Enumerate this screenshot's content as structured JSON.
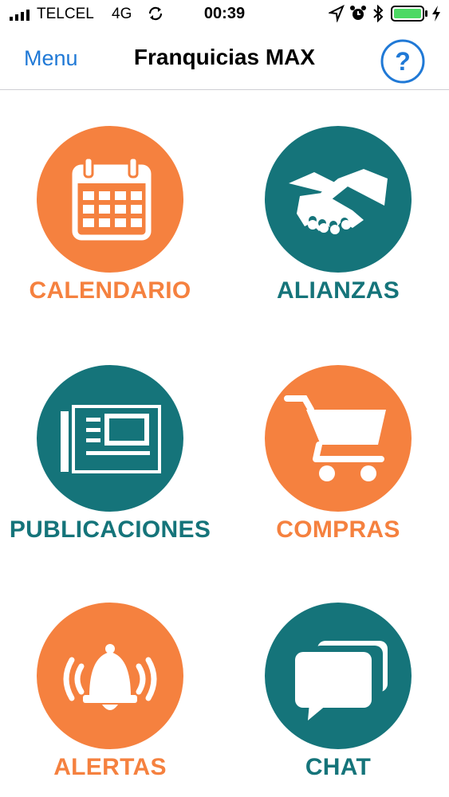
{
  "status_bar": {
    "carrier": "TELCEL",
    "network": "4G",
    "time": "00:39",
    "icons": [
      "signal-icon",
      "sync-icon",
      "location-icon",
      "alarm-icon",
      "bluetooth-icon",
      "battery-icon",
      "charging-icon"
    ]
  },
  "nav": {
    "menu_label": "Menu",
    "title": "Franquicias MAX",
    "help_icon": "help-icon"
  },
  "colors": {
    "orange": "#f5813f",
    "teal": "#15747a",
    "link_blue": "#2079d6"
  },
  "tiles": [
    {
      "label": "CALENDARIO",
      "icon": "calendar-icon",
      "color": "orange"
    },
    {
      "label": "ALIANZAS",
      "icon": "handshake-icon",
      "color": "teal"
    },
    {
      "label": "PUBLICACIONES",
      "icon": "newspaper-icon",
      "color": "teal"
    },
    {
      "label": "COMPRAS",
      "icon": "shopping-cart-icon",
      "color": "orange"
    },
    {
      "label": "ALERTAS",
      "icon": "bell-icon",
      "color": "orange"
    },
    {
      "label": "CHAT",
      "icon": "chat-icon",
      "color": "teal"
    }
  ]
}
